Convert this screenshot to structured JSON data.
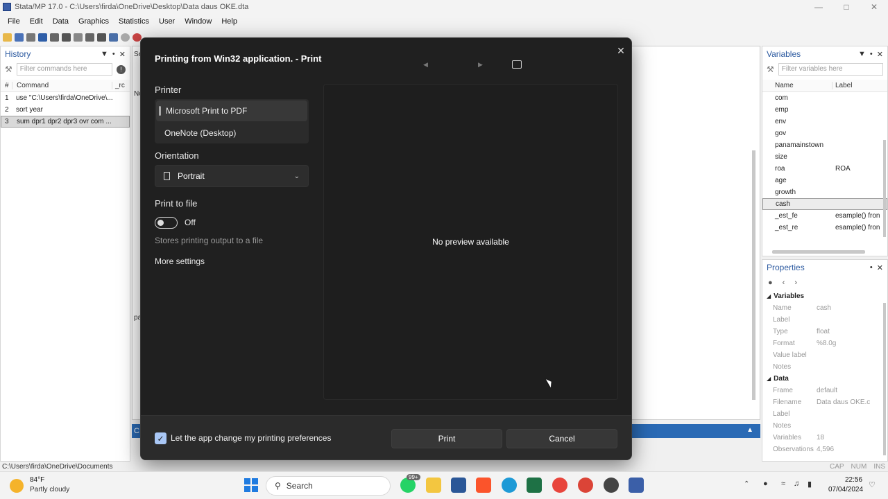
{
  "window": {
    "title": "Stata/MP 17.0 - C:\\Users\\firda\\OneDrive\\Desktop\\Data daus OKE.dta"
  },
  "menu": [
    "File",
    "Edit",
    "Data",
    "Graphics",
    "Statistics",
    "User",
    "Window",
    "Help"
  ],
  "history": {
    "title": "History",
    "filter_placeholder": "Filter commands here",
    "col_hash": "#",
    "col_command": "Command",
    "col_rc": "_rc",
    "rows": [
      {
        "n": "1",
        "cmd": "use \"C:\\Users\\firda\\OneDrive\\..."
      },
      {
        "n": "2",
        "cmd": "sort year"
      },
      {
        "n": "3",
        "cmd": "sum dpr1 dpr2 dpr3 ovr com ..."
      }
    ]
  },
  "variables": {
    "title": "Variables",
    "filter_placeholder": "Filter variables here",
    "col_name": "Name",
    "col_label": "Label",
    "rows": [
      {
        "name": "com",
        "label": ""
      },
      {
        "name": "emp",
        "label": ""
      },
      {
        "name": "env",
        "label": ""
      },
      {
        "name": "gov",
        "label": ""
      },
      {
        "name": "panamainstown",
        "label": ""
      },
      {
        "name": "size",
        "label": ""
      },
      {
        "name": "roa",
        "label": "ROA"
      },
      {
        "name": "age",
        "label": ""
      },
      {
        "name": "growth",
        "label": ""
      },
      {
        "name": "cash",
        "label": ""
      },
      {
        "name": "_est_fe",
        "label": "esample() fron"
      },
      {
        "name": "_est_re",
        "label": "esample() fron"
      }
    ]
  },
  "properties": {
    "title": "Properties",
    "sec_vars": "Variables",
    "var_rows": [
      {
        "k": "Name",
        "v": "cash"
      },
      {
        "k": "Label",
        "v": ""
      },
      {
        "k": "Type",
        "v": "float"
      },
      {
        "k": "Format",
        "v": "%8.0g"
      },
      {
        "k": "Value label",
        "v": ""
      },
      {
        "k": "Notes",
        "v": ""
      }
    ],
    "sec_data": "Data",
    "data_rows": [
      {
        "k": "Frame",
        "v": "default"
      },
      {
        "k": "Filename",
        "v": "Data daus OKE.c"
      },
      {
        "k": "Label",
        "v": ""
      },
      {
        "k": "Notes",
        "v": ""
      },
      {
        "k": "Variables",
        "v": "18"
      },
      {
        "k": "Observations",
        "v": "4,596"
      }
    ]
  },
  "status": {
    "path": "C:\\Users\\firda\\OneDrive\\Documents",
    "cap": "CAP",
    "num": "NUM",
    "ins": "INS"
  },
  "results": {
    "side_a": "Se",
    "side_b": "No",
    "side_c": "pa",
    "side_d": "C"
  },
  "dialog": {
    "title": "Printing from Win32 application. - Print",
    "printer_label": "Printer",
    "printers": [
      "Microsoft Print to PDF",
      "OneNote (Desktop)"
    ],
    "orientation_label": "Orientation",
    "orientation_value": "Portrait",
    "print_to_file_label": "Print to file",
    "toggle_state": "Off",
    "stores_text": "Stores printing output to a file",
    "more_settings": "More settings",
    "preview_text": "No preview available",
    "checkbox_label": "Let the app change my printing preferences",
    "print_btn": "Print",
    "cancel_btn": "Cancel"
  },
  "taskbar": {
    "temp": "84°F",
    "weather": "Partly cloudy",
    "search": "Search",
    "badge": "99+",
    "time": "22:56",
    "date": "07/04/2024"
  },
  "colors": {
    "accent": "#2a6ab5",
    "dialog_bg": "#202020",
    "checkbox": "#a9c7f5"
  }
}
